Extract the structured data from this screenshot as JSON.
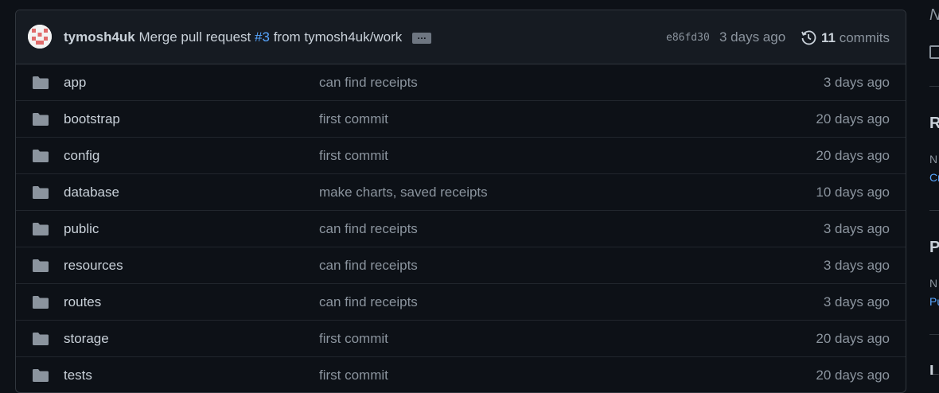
{
  "latest_commit": {
    "author": "tymosh4uk",
    "message_prefix": "Merge pull request",
    "pr_number": "#3",
    "message_suffix": "from tymosh4uk/work",
    "ellipsis": "…",
    "sha": "e86fd30",
    "time": "3 days ago",
    "commit_count": "11",
    "commits_label": "commits"
  },
  "files": [
    {
      "name": "app",
      "message": "can find receipts",
      "time": "3 days ago",
      "icon": "folder-icon"
    },
    {
      "name": "bootstrap",
      "message": "first commit",
      "time": "20 days ago",
      "icon": "folder-icon"
    },
    {
      "name": "config",
      "message": "first commit",
      "time": "20 days ago",
      "icon": "folder-icon"
    },
    {
      "name": "database",
      "message": "make charts, saved receipts",
      "time": "10 days ago",
      "icon": "folder-icon"
    },
    {
      "name": "public",
      "message": "can find receipts",
      "time": "3 days ago",
      "icon": "folder-icon"
    },
    {
      "name": "resources",
      "message": "can find receipts",
      "time": "3 days ago",
      "icon": "folder-icon"
    },
    {
      "name": "routes",
      "message": "can find receipts",
      "time": "3 days ago",
      "icon": "folder-icon"
    },
    {
      "name": "storage",
      "message": "first commit",
      "time": "20 days ago",
      "icon": "folder-icon"
    },
    {
      "name": "tests",
      "message": "first commit",
      "time": "20 days ago",
      "icon": "folder-icon"
    }
  ],
  "sidebar": {
    "fragments": [
      "N",
      "R",
      "N",
      "Cr",
      "P",
      "N",
      "Pu",
      "L"
    ]
  },
  "colors": {
    "background": "#0d1117",
    "header": "#161b22",
    "border": "#30363d",
    "link": "#58a6ff",
    "muted": "#8b949e",
    "text": "#c9d1d9"
  }
}
